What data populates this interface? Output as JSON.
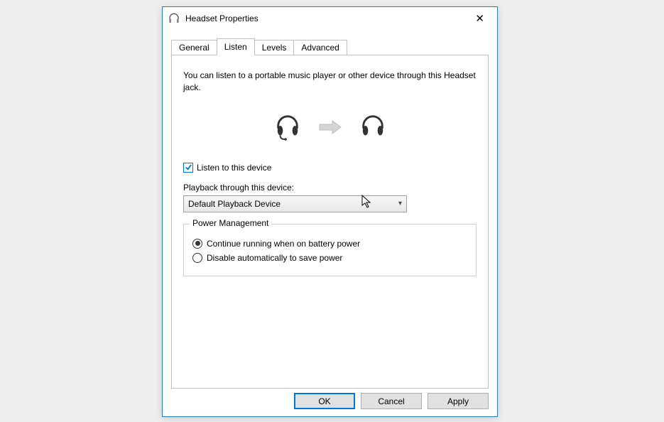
{
  "dialog": {
    "title": "Headset Properties",
    "tabs": [
      "General",
      "Listen",
      "Levels",
      "Advanced"
    ],
    "active_tab": "Listen",
    "description": "You can listen to a portable music player or other device through this Headset jack.",
    "listen_checkbox": {
      "label": "Listen to this device",
      "checked": true
    },
    "playback_label": "Playback through this device:",
    "playback_value": "Default Playback Device",
    "power_group": {
      "title": "Power Management",
      "options": [
        {
          "label": "Continue running when on battery power",
          "checked": true
        },
        {
          "label": "Disable automatically to save power",
          "checked": false
        }
      ]
    },
    "buttons": {
      "ok": "OK",
      "cancel": "Cancel",
      "apply": "Apply"
    }
  }
}
